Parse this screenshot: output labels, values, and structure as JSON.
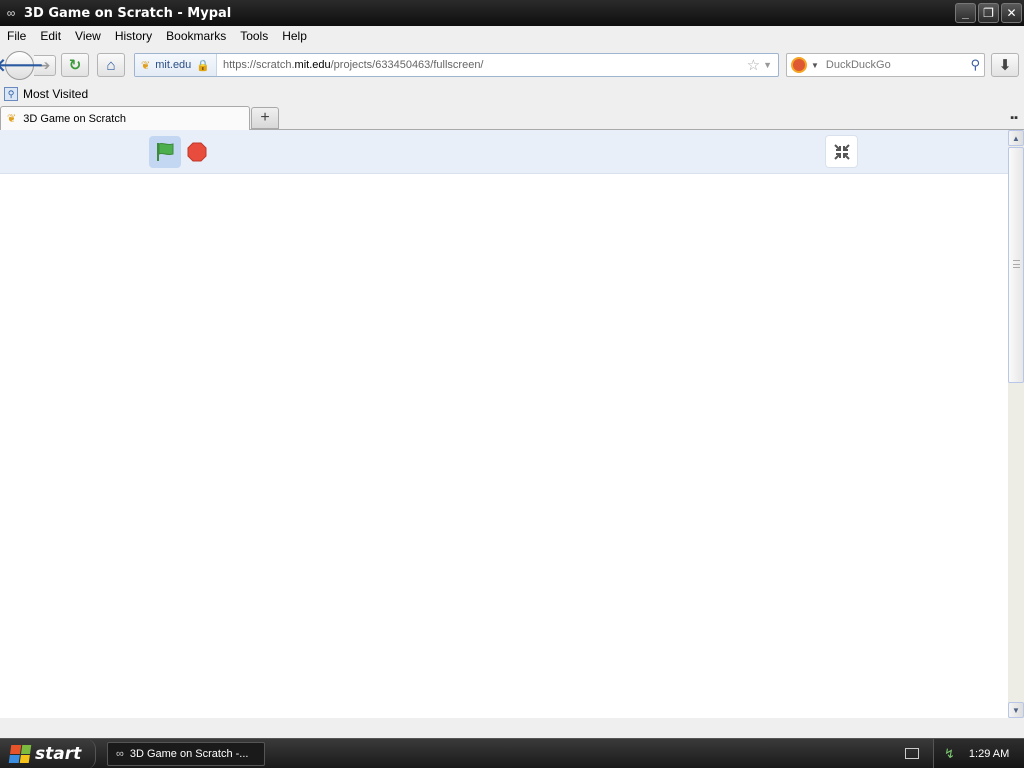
{
  "window": {
    "title": "3D Game on Scratch - Mypal",
    "controls": {
      "minimize": "_",
      "maximize": "❐",
      "close": "✕"
    }
  },
  "menubar": {
    "items": [
      "File",
      "Edit",
      "View",
      "History",
      "Bookmarks",
      "Tools",
      "Help"
    ]
  },
  "navbar": {
    "identity_label": "mit.edu",
    "url_prefix": "https://scratch.",
    "url_host": "mit.edu",
    "url_suffix": "/projects/633450463/fullscreen/",
    "search_placeholder": "DuckDuckGo"
  },
  "bookmarks": {
    "items": [
      "Most Visited"
    ]
  },
  "tabs": {
    "active_tab_label": "3D Game on Scratch",
    "new_tab": "+"
  },
  "stage": {
    "flag_color": "#4cae4c",
    "stop_color": "#e74c3c",
    "controls_bg": "#e9eff8"
  },
  "taskbar": {
    "start_label": "start",
    "task_label": "3D Game on Scratch -...",
    "clock": "1:29 AM"
  }
}
